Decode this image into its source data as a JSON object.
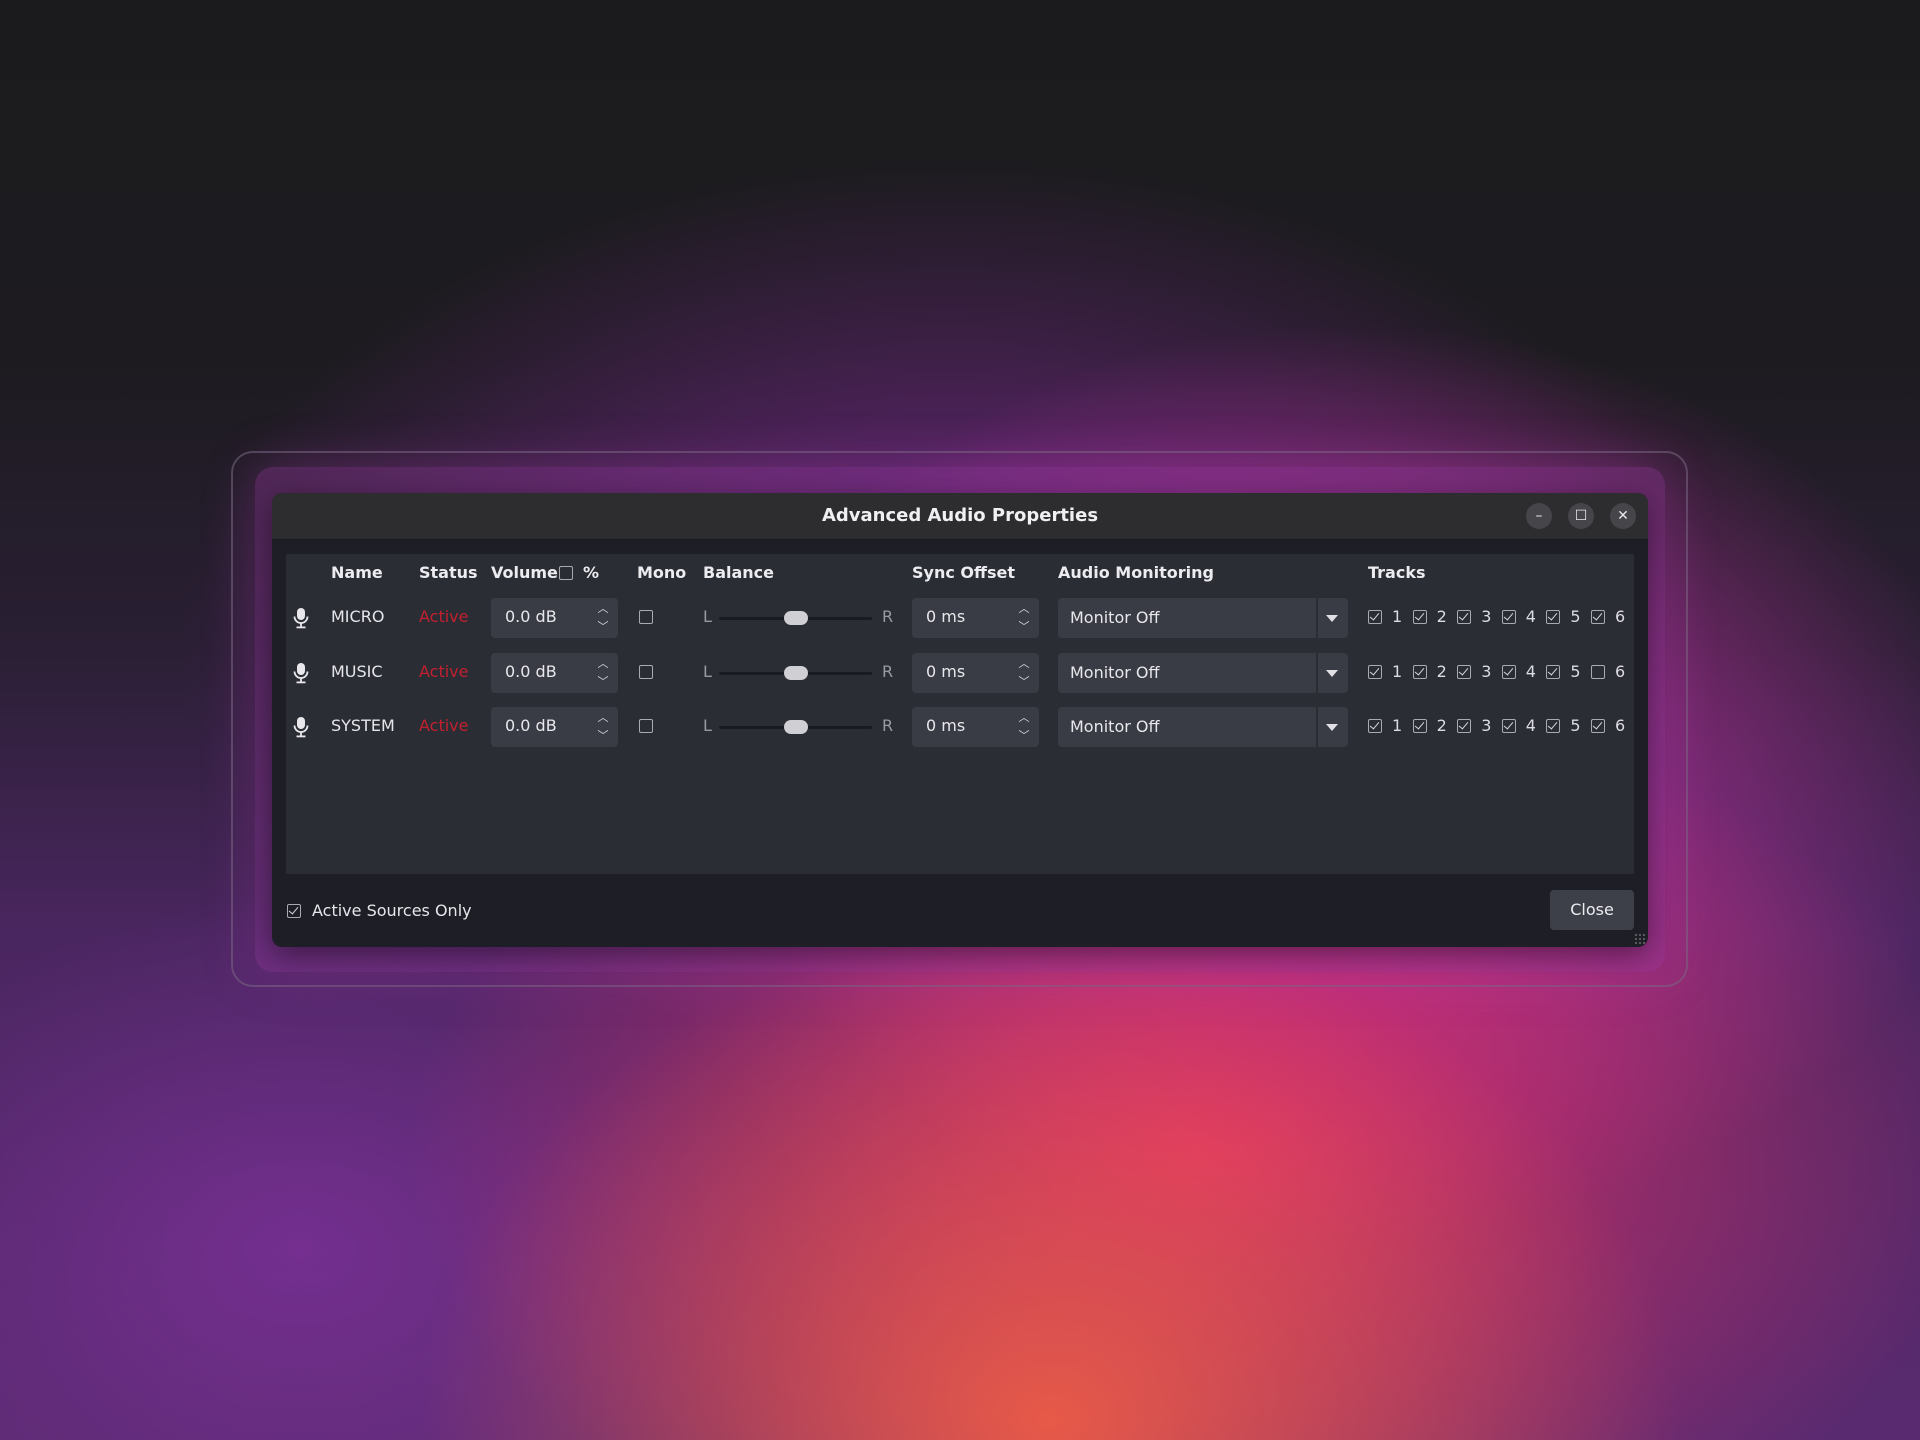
{
  "window": {
    "title": "Advanced Audio Properties",
    "minimize_icon": "minimize-icon",
    "maximize_icon": "maximize-icon",
    "close_icon": "close-icon"
  },
  "columns": {
    "name": "Name",
    "status": "Status",
    "volume": "Volume",
    "percent": "%",
    "percent_checked": false,
    "mono": "Mono",
    "balance": "Balance",
    "sync_offset": "Sync Offset",
    "audio_monitoring": "Audio Monitoring",
    "tracks": "Tracks"
  },
  "balance_labels": {
    "left": "L",
    "right": "R"
  },
  "sources": [
    {
      "icon": "microphone-icon",
      "name": "MICRO",
      "status": "Active",
      "volume": "0.0 dB",
      "mono": false,
      "balance": 0.5,
      "sync_offset": "0 ms",
      "monitoring": "Monitor Off",
      "tracks": [
        {
          "label": "1",
          "checked": true
        },
        {
          "label": "2",
          "checked": true
        },
        {
          "label": "3",
          "checked": true
        },
        {
          "label": "4",
          "checked": true
        },
        {
          "label": "5",
          "checked": true
        },
        {
          "label": "6",
          "checked": true
        }
      ]
    },
    {
      "icon": "microphone-icon",
      "name": "MUSIC",
      "status": "Active",
      "volume": "0.0 dB",
      "mono": false,
      "balance": 0.5,
      "sync_offset": "0 ms",
      "monitoring": "Monitor Off",
      "tracks": [
        {
          "label": "1",
          "checked": true
        },
        {
          "label": "2",
          "checked": true
        },
        {
          "label": "3",
          "checked": true
        },
        {
          "label": "4",
          "checked": true
        },
        {
          "label": "5",
          "checked": true
        },
        {
          "label": "6",
          "checked": false
        }
      ]
    },
    {
      "icon": "microphone-icon",
      "name": "SYSTEM",
      "status": "Active",
      "volume": "0.0 dB",
      "mono": false,
      "balance": 0.5,
      "sync_offset": "0 ms",
      "monitoring": "Monitor Off",
      "tracks": [
        {
          "label": "1",
          "checked": true
        },
        {
          "label": "2",
          "checked": true
        },
        {
          "label": "3",
          "checked": true
        },
        {
          "label": "4",
          "checked": true
        },
        {
          "label": "5",
          "checked": true
        },
        {
          "label": "6",
          "checked": true
        }
      ]
    }
  ],
  "footer": {
    "active_sources_only": "Active Sources Only",
    "active_sources_only_checked": true,
    "close_button": "Close"
  },
  "colors": {
    "status_active": "#c2202e",
    "window_bg": "#1e1f26",
    "panel_bg": "#2b2d35"
  }
}
